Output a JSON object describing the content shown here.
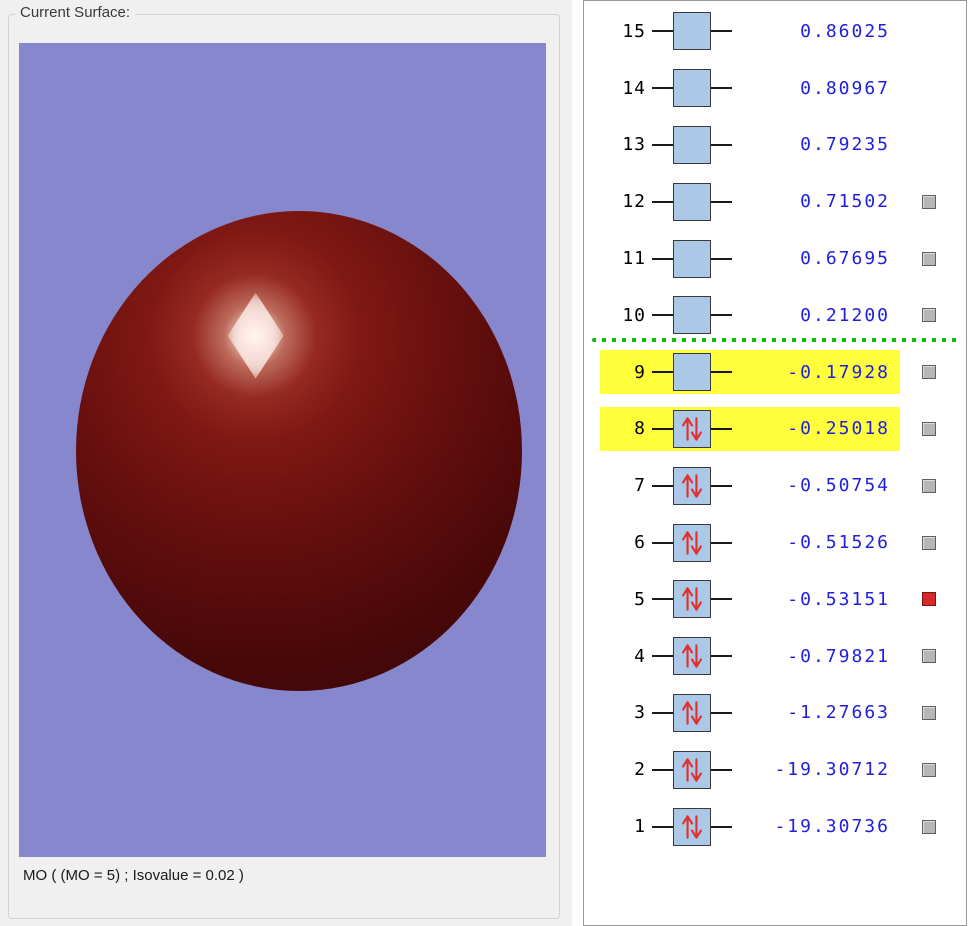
{
  "surface_panel": {
    "group_label": "Current Surface:",
    "caption": "MO ( (MO = 5) ; Isovalue = 0.02 )"
  },
  "mo_panel": {
    "fermi_after_index": 10,
    "levels": [
      {
        "index": 15,
        "energy": "0.86025",
        "occupied": false,
        "highlighted": false,
        "checkbox": "none"
      },
      {
        "index": 14,
        "energy": "0.80967",
        "occupied": false,
        "highlighted": false,
        "checkbox": "none"
      },
      {
        "index": 13,
        "energy": "0.79235",
        "occupied": false,
        "highlighted": false,
        "checkbox": "none"
      },
      {
        "index": 12,
        "energy": "0.71502",
        "occupied": false,
        "highlighted": false,
        "checkbox": "gray"
      },
      {
        "index": 11,
        "energy": "0.67695",
        "occupied": false,
        "highlighted": false,
        "checkbox": "gray"
      },
      {
        "index": 10,
        "energy": "0.21200",
        "occupied": false,
        "highlighted": false,
        "checkbox": "gray"
      },
      {
        "index": 9,
        "energy": "-0.17928",
        "occupied": false,
        "highlighted": true,
        "checkbox": "gray"
      },
      {
        "index": 8,
        "energy": "-0.25018",
        "occupied": true,
        "highlighted": true,
        "checkbox": "gray"
      },
      {
        "index": 7,
        "energy": "-0.50754",
        "occupied": true,
        "highlighted": false,
        "checkbox": "gray"
      },
      {
        "index": 6,
        "energy": "-0.51526",
        "occupied": true,
        "highlighted": false,
        "checkbox": "gray"
      },
      {
        "index": 5,
        "energy": "-0.53151",
        "occupied": true,
        "highlighted": false,
        "checkbox": "red"
      },
      {
        "index": 4,
        "energy": "-0.79821",
        "occupied": true,
        "highlighted": false,
        "checkbox": "gray"
      },
      {
        "index": 3,
        "energy": "-1.27663",
        "occupied": true,
        "highlighted": false,
        "checkbox": "gray"
      },
      {
        "index": 2,
        "energy": "-19.30712",
        "occupied": true,
        "highlighted": false,
        "checkbox": "gray"
      },
      {
        "index": 1,
        "energy": "-19.30736",
        "occupied": true,
        "highlighted": false,
        "checkbox": "gray"
      }
    ]
  },
  "colors": {
    "window_bg": "#f0f0f0",
    "viewport_bg": "#8687cd",
    "sphere_dark_red": "#6e1210",
    "panel_bg": "#ffffff",
    "energy_text_blue": "#2020dd",
    "highlight_yellow": "#ffff3c",
    "fermi_green": "#0abe0a",
    "orbital_box_blue": "#abc8e6",
    "arrow_red": "#e03030",
    "checkbox_gray": "#b6b6b6",
    "checkbox_selected_red": "#d62a2a"
  }
}
